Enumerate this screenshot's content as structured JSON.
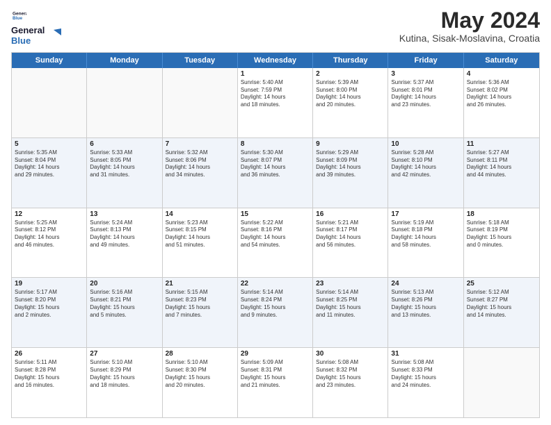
{
  "header": {
    "logo_line1": "General",
    "logo_line2": "Blue",
    "month": "May 2024",
    "location": "Kutina, Sisak-Moslavina, Croatia"
  },
  "weekdays": [
    "Sunday",
    "Monday",
    "Tuesday",
    "Wednesday",
    "Thursday",
    "Friday",
    "Saturday"
  ],
  "rows": [
    [
      {
        "day": "",
        "info": ""
      },
      {
        "day": "",
        "info": ""
      },
      {
        "day": "",
        "info": ""
      },
      {
        "day": "1",
        "info": "Sunrise: 5:40 AM\nSunset: 7:59 PM\nDaylight: 14 hours\nand 18 minutes."
      },
      {
        "day": "2",
        "info": "Sunrise: 5:39 AM\nSunset: 8:00 PM\nDaylight: 14 hours\nand 20 minutes."
      },
      {
        "day": "3",
        "info": "Sunrise: 5:37 AM\nSunset: 8:01 PM\nDaylight: 14 hours\nand 23 minutes."
      },
      {
        "day": "4",
        "info": "Sunrise: 5:36 AM\nSunset: 8:02 PM\nDaylight: 14 hours\nand 26 minutes."
      }
    ],
    [
      {
        "day": "5",
        "info": "Sunrise: 5:35 AM\nSunset: 8:04 PM\nDaylight: 14 hours\nand 29 minutes."
      },
      {
        "day": "6",
        "info": "Sunrise: 5:33 AM\nSunset: 8:05 PM\nDaylight: 14 hours\nand 31 minutes."
      },
      {
        "day": "7",
        "info": "Sunrise: 5:32 AM\nSunset: 8:06 PM\nDaylight: 14 hours\nand 34 minutes."
      },
      {
        "day": "8",
        "info": "Sunrise: 5:30 AM\nSunset: 8:07 PM\nDaylight: 14 hours\nand 36 minutes."
      },
      {
        "day": "9",
        "info": "Sunrise: 5:29 AM\nSunset: 8:09 PM\nDaylight: 14 hours\nand 39 minutes."
      },
      {
        "day": "10",
        "info": "Sunrise: 5:28 AM\nSunset: 8:10 PM\nDaylight: 14 hours\nand 42 minutes."
      },
      {
        "day": "11",
        "info": "Sunrise: 5:27 AM\nSunset: 8:11 PM\nDaylight: 14 hours\nand 44 minutes."
      }
    ],
    [
      {
        "day": "12",
        "info": "Sunrise: 5:25 AM\nSunset: 8:12 PM\nDaylight: 14 hours\nand 46 minutes."
      },
      {
        "day": "13",
        "info": "Sunrise: 5:24 AM\nSunset: 8:13 PM\nDaylight: 14 hours\nand 49 minutes."
      },
      {
        "day": "14",
        "info": "Sunrise: 5:23 AM\nSunset: 8:15 PM\nDaylight: 14 hours\nand 51 minutes."
      },
      {
        "day": "15",
        "info": "Sunrise: 5:22 AM\nSunset: 8:16 PM\nDaylight: 14 hours\nand 54 minutes."
      },
      {
        "day": "16",
        "info": "Sunrise: 5:21 AM\nSunset: 8:17 PM\nDaylight: 14 hours\nand 56 minutes."
      },
      {
        "day": "17",
        "info": "Sunrise: 5:19 AM\nSunset: 8:18 PM\nDaylight: 14 hours\nand 58 minutes."
      },
      {
        "day": "18",
        "info": "Sunrise: 5:18 AM\nSunset: 8:19 PM\nDaylight: 15 hours\nand 0 minutes."
      }
    ],
    [
      {
        "day": "19",
        "info": "Sunrise: 5:17 AM\nSunset: 8:20 PM\nDaylight: 15 hours\nand 2 minutes."
      },
      {
        "day": "20",
        "info": "Sunrise: 5:16 AM\nSunset: 8:21 PM\nDaylight: 15 hours\nand 5 minutes."
      },
      {
        "day": "21",
        "info": "Sunrise: 5:15 AM\nSunset: 8:23 PM\nDaylight: 15 hours\nand 7 minutes."
      },
      {
        "day": "22",
        "info": "Sunrise: 5:14 AM\nSunset: 8:24 PM\nDaylight: 15 hours\nand 9 minutes."
      },
      {
        "day": "23",
        "info": "Sunrise: 5:14 AM\nSunset: 8:25 PM\nDaylight: 15 hours\nand 11 minutes."
      },
      {
        "day": "24",
        "info": "Sunrise: 5:13 AM\nSunset: 8:26 PM\nDaylight: 15 hours\nand 13 minutes."
      },
      {
        "day": "25",
        "info": "Sunrise: 5:12 AM\nSunset: 8:27 PM\nDaylight: 15 hours\nand 14 minutes."
      }
    ],
    [
      {
        "day": "26",
        "info": "Sunrise: 5:11 AM\nSunset: 8:28 PM\nDaylight: 15 hours\nand 16 minutes."
      },
      {
        "day": "27",
        "info": "Sunrise: 5:10 AM\nSunset: 8:29 PM\nDaylight: 15 hours\nand 18 minutes."
      },
      {
        "day": "28",
        "info": "Sunrise: 5:10 AM\nSunset: 8:30 PM\nDaylight: 15 hours\nand 20 minutes."
      },
      {
        "day": "29",
        "info": "Sunrise: 5:09 AM\nSunset: 8:31 PM\nDaylight: 15 hours\nand 21 minutes."
      },
      {
        "day": "30",
        "info": "Sunrise: 5:08 AM\nSunset: 8:32 PM\nDaylight: 15 hours\nand 23 minutes."
      },
      {
        "day": "31",
        "info": "Sunrise: 5:08 AM\nSunset: 8:33 PM\nDaylight: 15 hours\nand 24 minutes."
      },
      {
        "day": "",
        "info": ""
      }
    ]
  ]
}
